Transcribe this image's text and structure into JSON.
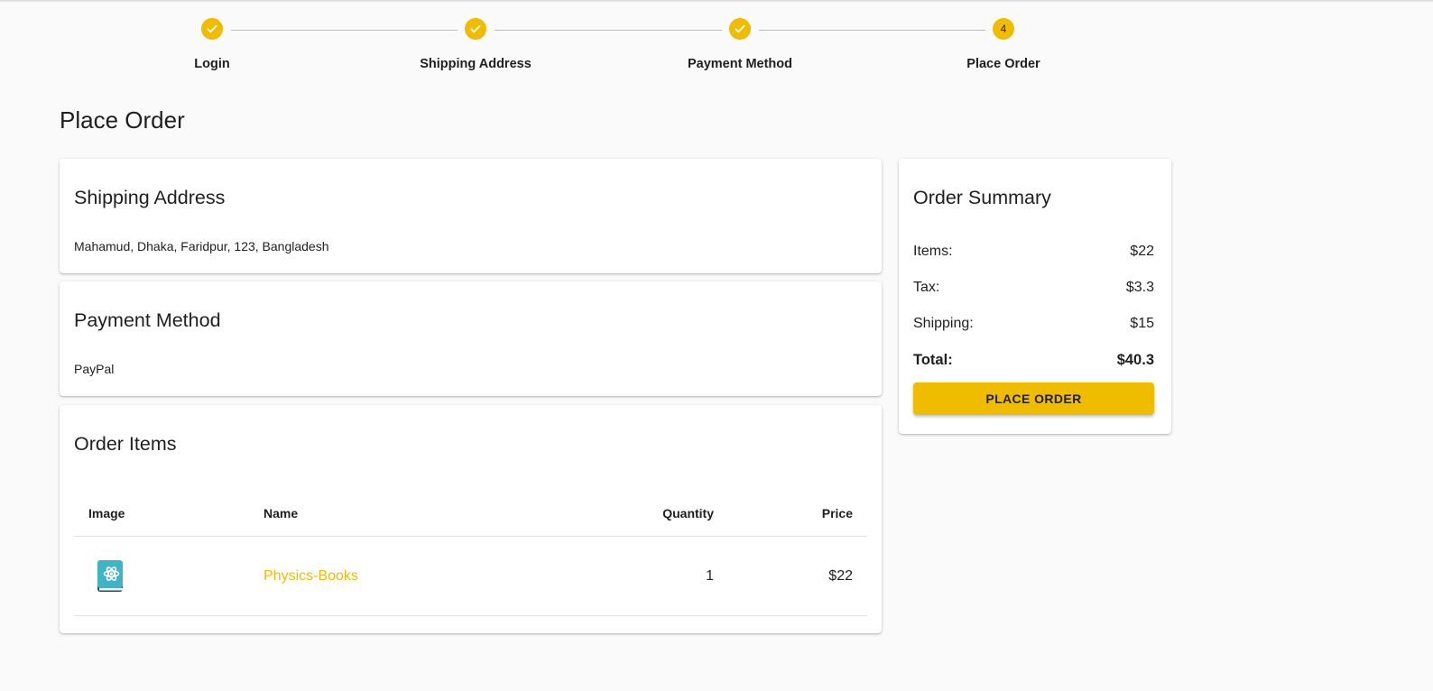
{
  "stepper": {
    "steps": [
      {
        "label": "Login",
        "state": "complete",
        "icon": "check-icon"
      },
      {
        "label": "Shipping Address",
        "state": "complete",
        "icon": "check-icon"
      },
      {
        "label": "Payment Method",
        "state": "complete",
        "icon": "check-icon"
      },
      {
        "label": "Place Order",
        "state": "active",
        "number": "4"
      }
    ]
  },
  "page": {
    "title": "Place Order"
  },
  "shipping": {
    "title": "Shipping Address",
    "address": "Mahamud, Dhaka, Faridpur, 123, Bangladesh"
  },
  "payment": {
    "title": "Payment Method",
    "method": "PayPal"
  },
  "order_items": {
    "title": "Order Items",
    "columns": [
      "Image",
      "Name",
      "Quantity",
      "Price"
    ],
    "rows": [
      {
        "image_icon": "physics-book-icon",
        "name": "Physics-Books",
        "quantity": "1",
        "price": "$22"
      }
    ]
  },
  "summary": {
    "title": "Order Summary",
    "items_label": "Items:",
    "items_value": "$22",
    "tax_label": "Tax:",
    "tax_value": "$3.3",
    "shipping_label": "Shipping:",
    "shipping_value": "$15",
    "total_label": "Total:",
    "total_value": "$40.3",
    "button_label": "PLACE ORDER"
  },
  "colors": {
    "accent": "#f0bc00",
    "background": "#fafafa",
    "card": "#ffffff",
    "text": "#1f1f1f"
  }
}
